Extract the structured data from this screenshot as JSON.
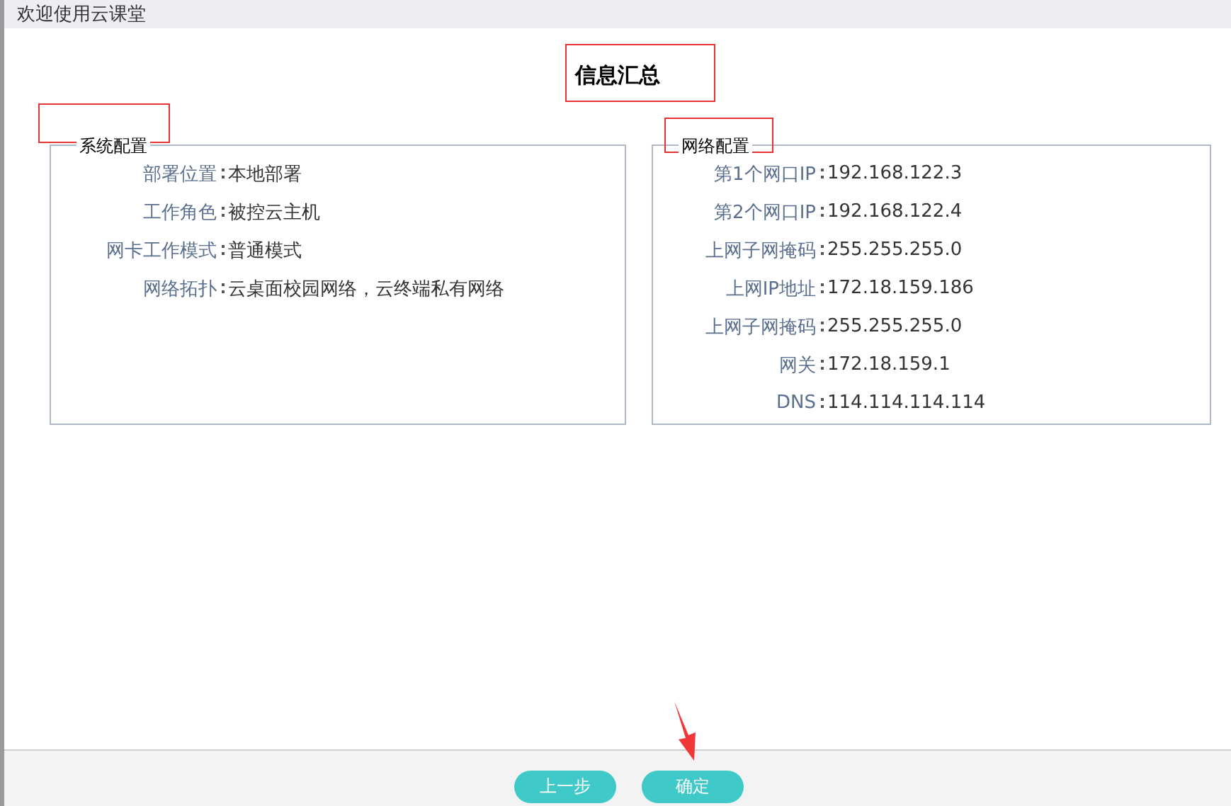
{
  "window": {
    "title": "欢迎使用云课堂"
  },
  "heading": "信息汇总",
  "panels": [
    {
      "title": "系统配置",
      "rows": [
        {
          "label": "部署位置",
          "value": "本地部署"
        },
        {
          "label": "工作角色",
          "value": "被控云主机"
        },
        {
          "label": "网卡工作模式",
          "value": "普通模式"
        },
        {
          "label": "网络拓扑",
          "value": "云桌面校园网络，云终端私有网络"
        }
      ]
    },
    {
      "title": "网络配置",
      "rows": [
        {
          "label": "第1个网口IP",
          "value": "192.168.122.3"
        },
        {
          "label": "第2个网口IP",
          "value": "192.168.122.4"
        },
        {
          "label": "上网子网掩码",
          "value": "255.255.255.0"
        },
        {
          "label": "上网IP地址",
          "value": "172.18.159.186"
        },
        {
          "label": "上网子网掩码",
          "value": "255.255.255.0"
        },
        {
          "label": "网关",
          "value": "172.18.159.1"
        },
        {
          "label": "DNS",
          "value": "114.114.114.114"
        }
      ]
    }
  ],
  "buttons": [
    "上一步",
    "确定"
  ]
}
